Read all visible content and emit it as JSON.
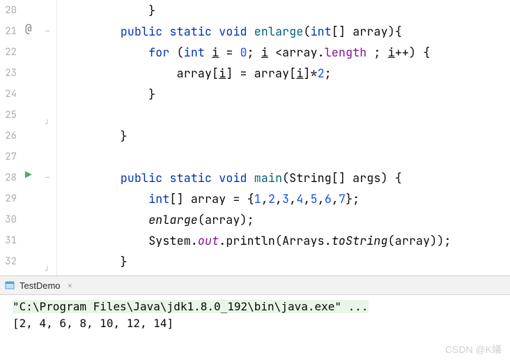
{
  "gutter": {
    "lines": [
      "20",
      "21",
      "22",
      "23",
      "24",
      "25",
      "26",
      "27",
      "28",
      "29",
      "30",
      "31",
      "32"
    ]
  },
  "markers": {
    "at": "@",
    "play": "▶"
  },
  "code": {
    "l20": "            }",
    "l21_pre": "        ",
    "l21_kw1": "public",
    "l21_sp1": " ",
    "l21_kw2": "static",
    "l21_sp2": " ",
    "l21_kw3": "void",
    "l21_sp3": " ",
    "l21_fn": "enlarge",
    "l21_par": "(",
    "l21_kw4": "int",
    "l21_arr": "[] array){",
    "l22_pre": "            ",
    "l22_kw1": "for",
    "l22_par": " (",
    "l22_kw2": "int",
    "l22_sp": " ",
    "l22_i1": "i",
    "l22_eq": " = ",
    "l22_n0": "0",
    "l22_semi": "; ",
    "l22_i2": "i",
    "l22_mid": " <array.",
    "l22_len": "length",
    "l22_sp2": " ; ",
    "l22_i3": "i",
    "l22_end": "++) {",
    "l23_pre": "                array[",
    "l23_i1": "i",
    "l23_mid": "] = array[",
    "l23_i2": "i",
    "l23_mid2": "]*",
    "l23_n2": "2",
    "l23_end": ";",
    "l24": "            }",
    "l25": "",
    "l26": "        }",
    "l27": "",
    "l28_pre": "        ",
    "l28_kw1": "public",
    "l28_sp1": " ",
    "l28_kw2": "static",
    "l28_sp2": " ",
    "l28_kw3": "void",
    "l28_sp3": " ",
    "l28_fn": "main",
    "l28_par": "(String[] args) {",
    "l29_pre": "            ",
    "l29_kw": "int",
    "l29_mid": "[] array = {",
    "l29_n1": "1",
    "l29_c1": ",",
    "l29_n2": "2",
    "l29_c2": ",",
    "l29_n3": "3",
    "l29_c3": ",",
    "l29_n4": "4",
    "l29_c4": ",",
    "l29_n5": "5",
    "l29_c5": ",",
    "l29_n6": "6",
    "l29_c6": ",",
    "l29_n7": "7",
    "l29_end": "};",
    "l30_pre": "            ",
    "l30_fn": "enlarge",
    "l30_end": "(array);",
    "l31_pre": "            System.",
    "l31_out": "out",
    "l31_dot": ".println(Arrays.",
    "l31_ts": "toString",
    "l31_end": "(array));",
    "l32": "        }"
  },
  "runTab": {
    "label": "TestDemo",
    "close": "×"
  },
  "console": {
    "cmd": "\"C:\\Program Files\\Java\\jdk1.8.0_192\\bin\\java.exe\" ...",
    "output": "[2, 4, 6, 8, 10, 12, 14]"
  },
  "watermark": "CSDN @K嬟"
}
